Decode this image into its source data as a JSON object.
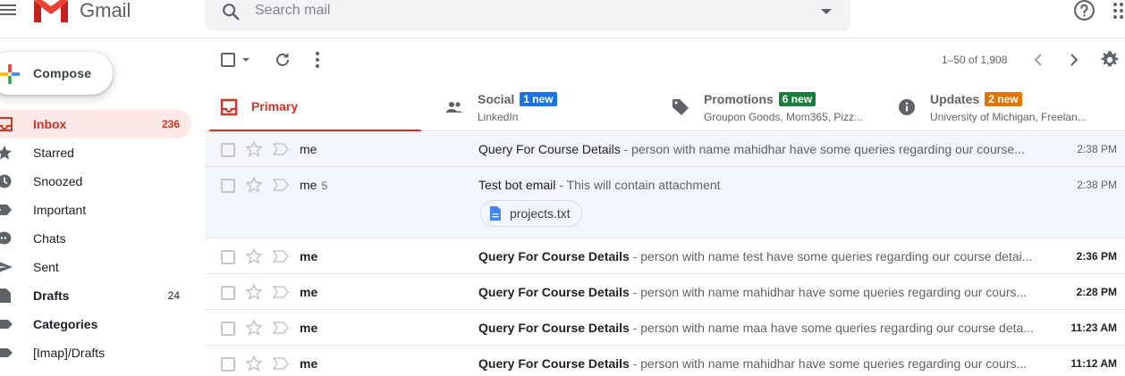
{
  "app": {
    "title": "Gmail",
    "accent_color": "#d93025"
  },
  "search": {
    "placeholder": "Search mail"
  },
  "compose": {
    "label": "Compose"
  },
  "sidebar": {
    "items": [
      {
        "label": "Inbox",
        "count": "236",
        "icon": "inbox-icon",
        "active": true
      },
      {
        "label": "Starred",
        "count": "",
        "icon": "star-icon"
      },
      {
        "label": "Snoozed",
        "count": "",
        "icon": "clock-icon"
      },
      {
        "label": "Important",
        "count": "",
        "icon": "important-icon"
      },
      {
        "label": "Chats",
        "count": "",
        "icon": "chat-icon"
      },
      {
        "label": "Sent",
        "count": "",
        "icon": "send-icon"
      },
      {
        "label": "Drafts",
        "count": "24",
        "icon": "draft-icon",
        "bold": true
      },
      {
        "label": "Categories",
        "count": "",
        "icon": "label-icon",
        "bold": true
      },
      {
        "label": "[Imap]/Drafts",
        "count": "",
        "icon": "label-icon"
      }
    ]
  },
  "toolbar": {
    "range": "1–50 of 1,908"
  },
  "tabs": [
    {
      "title": "Primary",
      "badge": "",
      "sub": "",
      "icon": "inbox-icon",
      "active": true
    },
    {
      "title": "Social",
      "badge": "1 new",
      "badge_color": "#1a73e8",
      "sub": "LinkedIn",
      "icon": "people-icon"
    },
    {
      "title": "Promotions",
      "badge": "6 new",
      "badge_color": "#188038",
      "sub": "Groupon Goods, Mom365, Pizz...",
      "icon": "tag-icon"
    },
    {
      "title": "Updates",
      "badge": "2 new",
      "badge_color": "#e37400",
      "sub": "University of Michigan, Freelan...",
      "icon": "info-icon"
    }
  ],
  "emails": [
    {
      "sender": "me",
      "count": "",
      "subject": "Query For Course Details",
      "snippet": " - person with name mahidhar have some queries regarding our course...",
      "time": "2:38 PM",
      "unread": false,
      "attachment": ""
    },
    {
      "sender": "me",
      "count": "5",
      "subject": "Test bot email",
      "snippet": " - This will contain attachment",
      "time": "2:38 PM",
      "unread": false,
      "attachment": "projects.txt"
    },
    {
      "sender": "me",
      "count": "",
      "subject": "Query For Course Details",
      "snippet": " - person with name test have some queries regarding our course detai...",
      "time": "2:36 PM",
      "unread": true,
      "attachment": ""
    },
    {
      "sender": "me",
      "count": "",
      "subject": "Query For Course Details",
      "snippet": " - person with name mahidhar have some queries regarding our cours...",
      "time": "2:28 PM",
      "unread": true,
      "attachment": ""
    },
    {
      "sender": "me",
      "count": "",
      "subject": "Query For Course Details",
      "snippet": " - person with name maa have some queries regarding our course deta...",
      "time": "11:23 AM",
      "unread": true,
      "attachment": ""
    },
    {
      "sender": "me",
      "count": "",
      "subject": "Query For Course Details",
      "snippet": " - person with name mahidhar have some queries regarding our cours...",
      "time": "11:12 AM",
      "unread": true,
      "attachment": ""
    }
  ]
}
